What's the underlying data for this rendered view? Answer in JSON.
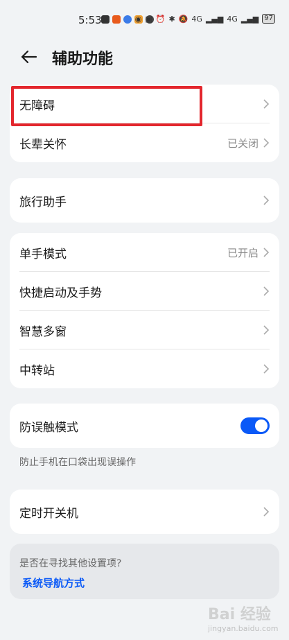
{
  "status_bar": {
    "time": "5:53",
    "signal_a": "4G",
    "signal_b": "4G",
    "battery": "97"
  },
  "header": {
    "title": "辅助功能",
    "back_icon": "back-arrow-icon"
  },
  "groups": {
    "g1": [
      {
        "label": "无障碍",
        "status": ""
      },
      {
        "label": "长辈关怀",
        "status": "已关闭"
      }
    ],
    "g2": [
      {
        "label": "旅行助手",
        "status": ""
      }
    ],
    "g3": [
      {
        "label": "单手模式",
        "status": "已开启"
      },
      {
        "label": "快捷启动及手势",
        "status": ""
      },
      {
        "label": "智慧多窗",
        "status": ""
      },
      {
        "label": "中转站",
        "status": ""
      }
    ],
    "g4": [
      {
        "label": "防误触模式",
        "toggle_on": true
      }
    ],
    "g5": [
      {
        "label": "定时开关机",
        "status": ""
      }
    ]
  },
  "g4_note": "防止手机在口袋出现误操作",
  "suggest": {
    "question": "是否在寻找其他设置项?",
    "link": "系统导航方式"
  },
  "watermark": {
    "text": "Bai 经验",
    "sub": "jingyan.baidu.com"
  },
  "colors": {
    "accent": "#0a59f7",
    "highlight": "#e3262d",
    "background": "#f1f3f5"
  }
}
